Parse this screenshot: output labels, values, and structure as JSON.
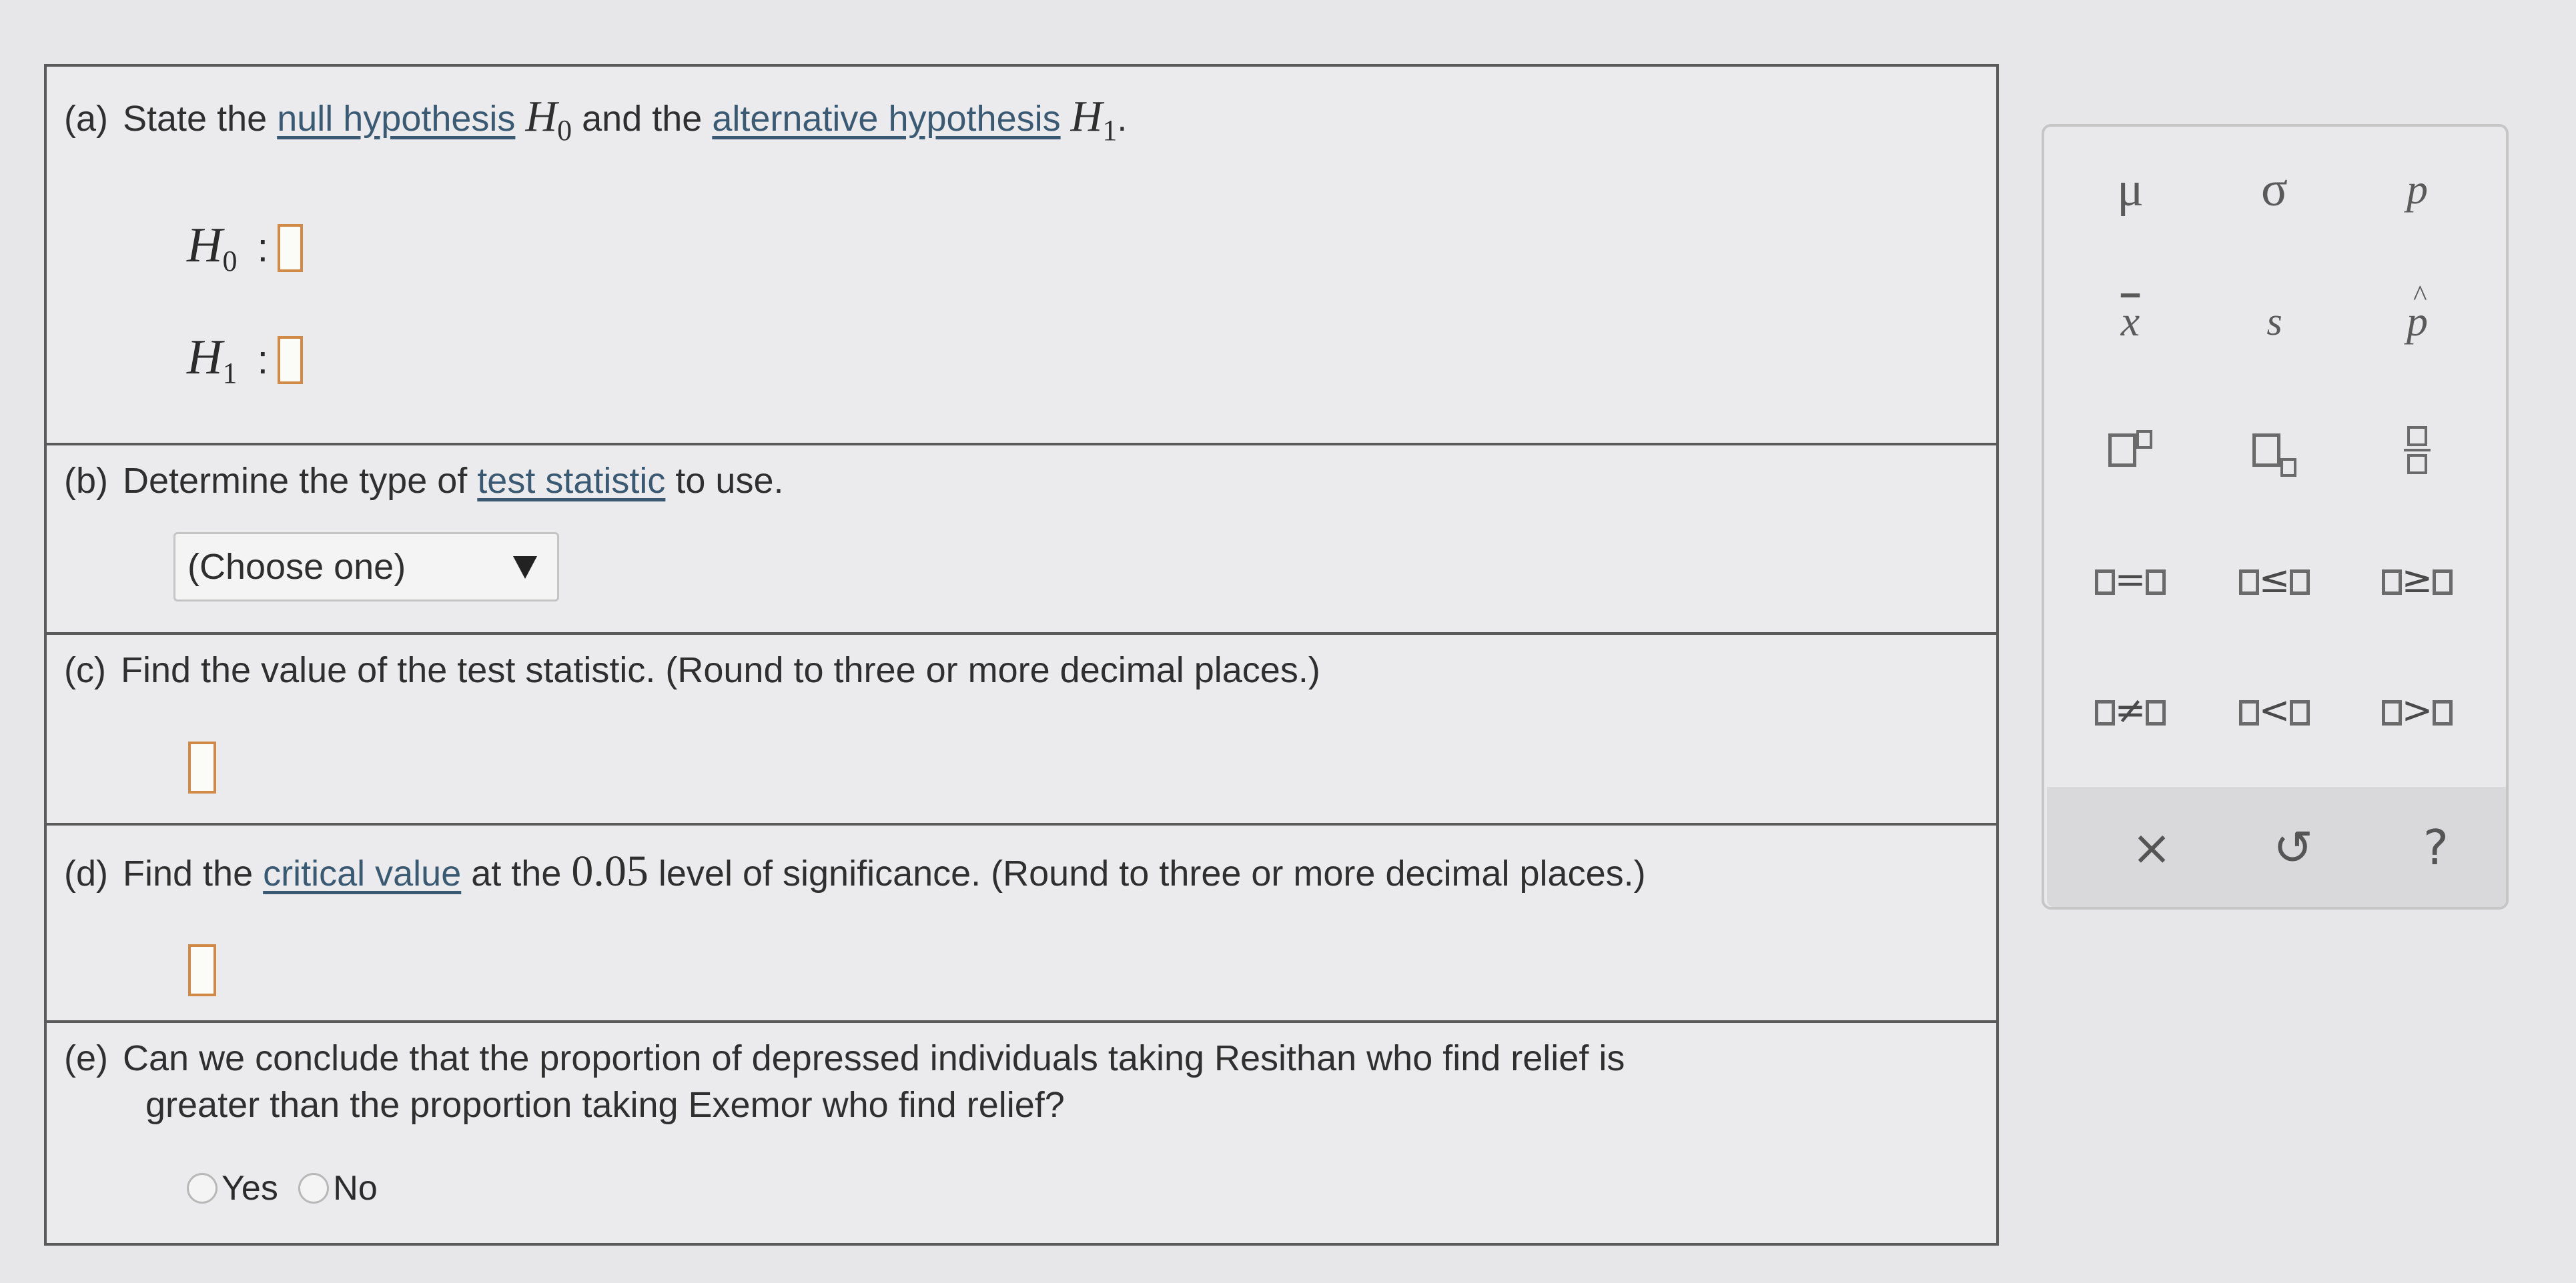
{
  "part_a": {
    "label": "(a)",
    "text1": "State the",
    "link_null": "null hypothesis",
    "h0_symbol": "H",
    "h0_sub": "0",
    "text2": "and the",
    "link_alt": "alternative hypothesis",
    "h1_symbol": "H",
    "h1_sub": "1",
    "period": ".",
    "row_h0_symbol": "H",
    "row_h0_sub": "0",
    "row_h1_symbol": "H",
    "row_h1_sub": "1",
    "colon": ":"
  },
  "part_b": {
    "label": "(b)",
    "text1": "Determine the type of",
    "link": "test statistic",
    "text2": "to use.",
    "select_value": "(Choose one)"
  },
  "part_c": {
    "label": "(c)",
    "text": "Find the value of the test statistic. (Round to three or more decimal places.)"
  },
  "part_d": {
    "label": "(d)",
    "text1": "Find the",
    "link": "critical value",
    "text2": "at the",
    "level": "0.05",
    "text3": "level of significance. (Round to three or more decimal places.)"
  },
  "part_e": {
    "label": "(e)",
    "line1": "Can we conclude that the proportion of depressed individuals taking Resithan who find relief is",
    "line2": "greater than the proportion taking Exemor who find relief?",
    "options": [
      "Yes",
      "No"
    ]
  },
  "palette": {
    "mu": "μ",
    "sigma": "σ",
    "p": "p",
    "xbar": "x",
    "s": "s",
    "phat": "p",
    "hat": "^",
    "eq": "=",
    "le": "≤",
    "ge": "≥",
    "ne": "≠",
    "lt": "<",
    "gt": ">",
    "clear": "×",
    "undo": "↺",
    "help": "?"
  }
}
